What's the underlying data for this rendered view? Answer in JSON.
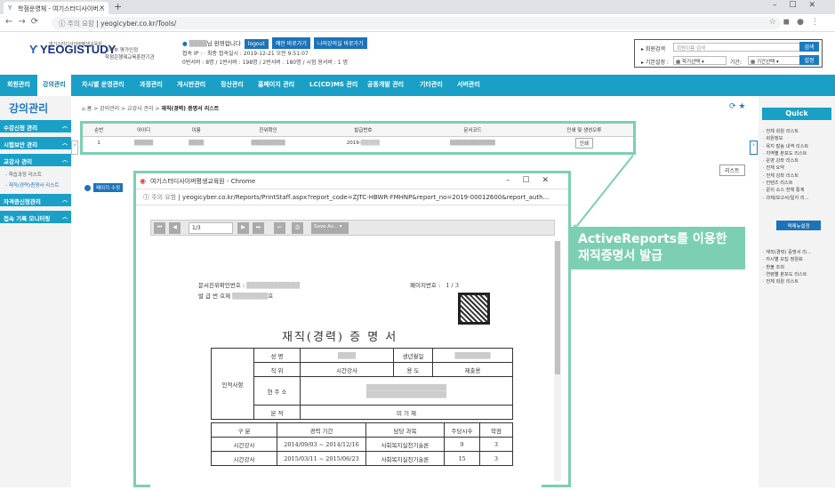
{
  "browser": {
    "tab_title": "학점운영체 - 여기스터디사이버...",
    "url_security": "주의 요함",
    "url_text": "yeogicyber.co.kr/Tools/"
  },
  "header": {
    "logo_text": "YEOGISTUDY",
    "logo_sub": "여기스터디사이버평생교육원",
    "logo_sub2_line1": "교육부 평가인정",
    "logo_sub2_line2": "학점은행제교육훈련기관",
    "welcome": "님 환영합니다",
    "btn_logout": "logout",
    "btn_site": "예안 바로가기",
    "btn_myroom": "나의강의실 바로가기",
    "line2": "접속 IP : · 최종 접속일시 : 2019-12-21 오전 9:51:07",
    "line3": "0번서버 : 8명 / 1번서버 : 198명 / 2번서버 : 180명 / 시험 용서버 : 1 명",
    "search_label": "회원검색",
    "search_placeholder": "회원이름 검색",
    "search_btn": "검색",
    "basic_label": "기본설정",
    "term_select": "학기선택",
    "period_label": "기간",
    "period_select": "기간선택",
    "set_btn": "설정"
  },
  "menu": [
    "회원관리",
    "강의관리",
    "차시별 운영관리",
    "과정관리",
    "게시판관리",
    "정산관리",
    "홈페이지 관리",
    "LC(CD)MS 관리",
    "공동개발 관리",
    "기타관리",
    "서버관리"
  ],
  "sidebar": {
    "title": "강의관리",
    "cats": [
      "수강신청 관리",
      "시험보안 관리",
      "교강사 관리",
      "자격증신청관리",
      "접속 기록 모니터링"
    ],
    "subs": [
      "- 학습과정 리스트",
      "- 재직(경력)증명서 리스트"
    ]
  },
  "main": {
    "breadcrumb_home": "홈",
    "breadcrumb_rest": "> 강의관리 > 교강사 관리 >",
    "breadcrumb_current": "재직(경력) 증명서 리스트",
    "table_headers": [
      "순번",
      "아이디",
      "이름",
      "진위확인",
      "발급번호",
      "문서코드",
      "인쇄 및 생성오류"
    ],
    "row_num": "1",
    "row_issue": "2019-",
    "print_btn": "인쇄",
    "list_btn": "리스트",
    "page_size_label": "페이지 수정"
  },
  "quick": {
    "title": "Quick",
    "list1": [
      "전체 회원 리스트",
      "회원정보",
      "욕지 발송 내역 리스트",
      "지역별 분포도 리스트",
      "운영 강좌 리스트",
      "전체 요약",
      "전체 강좌 리스트",
      "컨텐츠 리스트",
      "문의 소스 전체 통계",
      "과제/보고서/일지 리..."
    ],
    "btn": "퀵메뉴설정",
    "list2": [
      "재직(경력) 증명서 리...",
      "자시별 모집 정원표",
      "환불 조회",
      "연령별 분포도 리스트",
      "전체 회원 리스트"
    ]
  },
  "popup": {
    "title": "여기스터디사이버평생교육원 - Chrome",
    "security": "주의 요함",
    "url": "yeogicyber.co.kr/Reports/PrintStaff.aspx?report_code=ZJTC-HBWR-FMHNP&report_no=2019-00012600&report_auth...",
    "page_input": "1/3",
    "save_as": "Save As...",
    "doc_code_label": "문서진위확인번호 :",
    "doc_issue_label": "발 급 번 호제",
    "doc_issue_suffix": "호",
    "page_label": "페이지번호 :",
    "page_value": "1 / 3",
    "doc_title": "재직(경력) 증 명 서",
    "personal": "인적사항",
    "name": "성 명",
    "birth": "생년월일",
    "position": "직 위",
    "position_val": "시간강사",
    "use": "용 도",
    "use_val": "제출용",
    "address": "현 주 소",
    "origin": "본 적",
    "origin_val": "미 기 재",
    "career_headers": [
      "구 분",
      "경력 기간",
      "담당 과목",
      "주당시수",
      "학점"
    ],
    "career_rows": [
      [
        "시간강사",
        "2014/09/03 ~ 2014/12/16",
        "사회복지실천기술론",
        "9",
        "3"
      ],
      [
        "시간강사",
        "2015/03/11 ~ 2015/06/23",
        "사회복지실천기술론",
        "15",
        "3"
      ]
    ]
  },
  "annotation": {
    "line1": "ActiveReports를 이용한",
    "line2": "재직증명서 발급"
  }
}
